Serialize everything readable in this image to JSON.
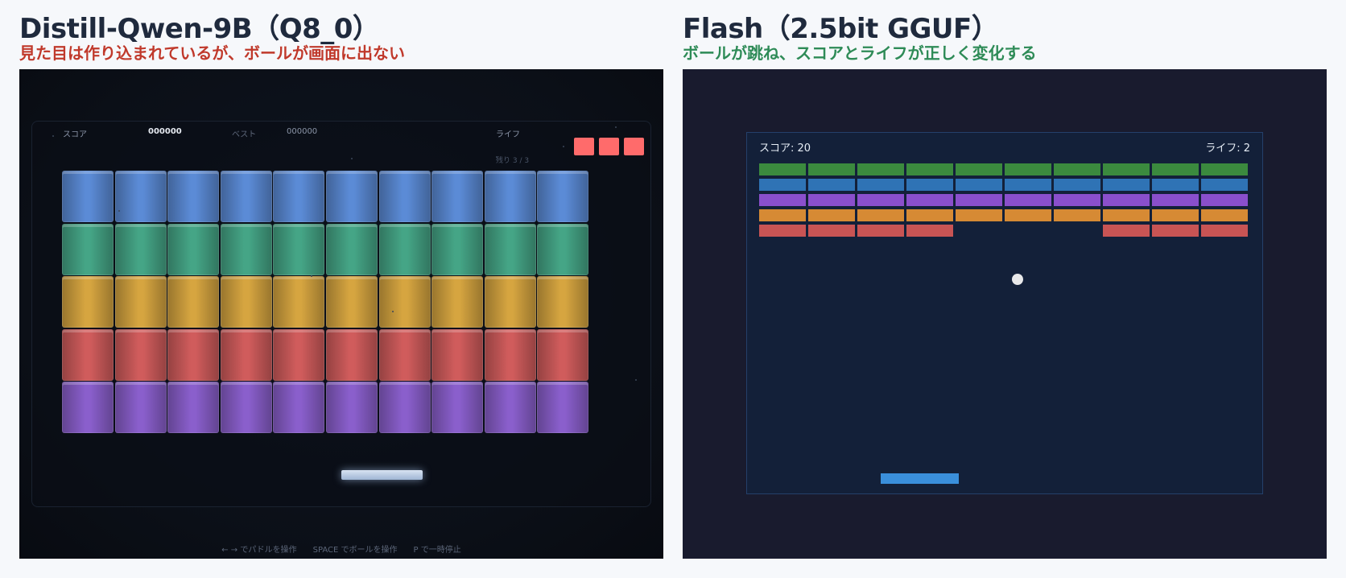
{
  "left": {
    "title": "Distill-Qwen-9B（Q8_0）",
    "subtitle": "見た目は作り込まれているが、ボールが画面に出ない",
    "hud": {
      "score_label": "スコア",
      "score_value": "000000",
      "best_label": "ベスト",
      "best_value": "000000",
      "lives_label": "ライフ",
      "remaining": "残り 3 / 3"
    },
    "lives": 3,
    "rows": 5,
    "cols": 10,
    "row_colors": [
      "#5b8bd6",
      "#45a586",
      "#d6a540",
      "#d05c5c",
      "#8a5fcc"
    ],
    "controls": [
      "← → でパドルを操作",
      "SPACE でボールを操作",
      "P で一時停止"
    ]
  },
  "right": {
    "title": "Flash（2.5bit GGUF）",
    "subtitle": "ボールが跳ね、スコアとライフが正しく変化する",
    "score_text": "スコア: 20",
    "lives_text": "ライフ: 2",
    "rows": 5,
    "cols": 10,
    "row_colors": [
      "#3b8a3e",
      "#2f73b5",
      "#8a4fcc",
      "#d68a34",
      "#c85454"
    ],
    "missing_bricks": [
      [
        4,
        4
      ],
      [
        4,
        5
      ],
      [
        4,
        6
      ]
    ]
  }
}
